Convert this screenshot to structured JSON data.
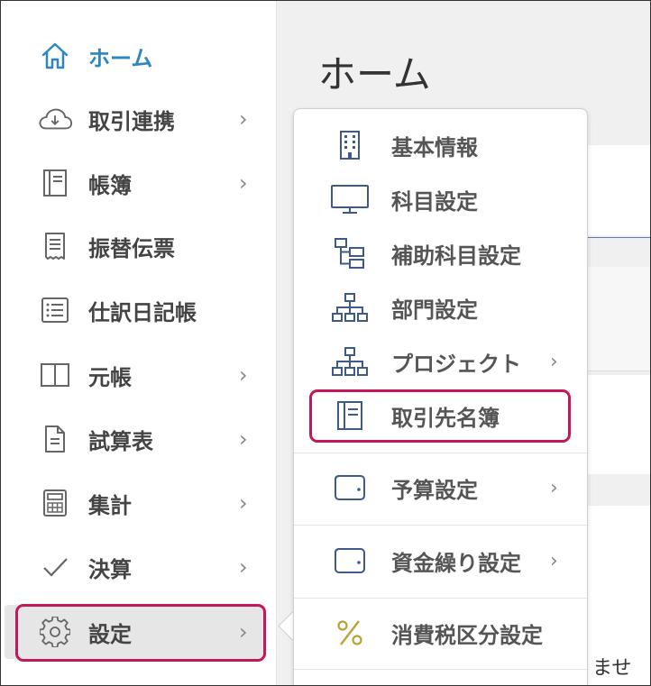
{
  "main": {
    "title": "ホーム",
    "partial_text": "ません"
  },
  "sidebar": {
    "items": [
      {
        "label": "ホーム",
        "icon": "home-icon",
        "chevron": ""
      },
      {
        "label": "取引連携",
        "icon": "cloud-download-icon",
        "chevron": "›"
      },
      {
        "label": "帳簿",
        "icon": "ledger-book-icon",
        "chevron": "›"
      },
      {
        "label": "振替伝票",
        "icon": "receipt-icon",
        "chevron": ""
      },
      {
        "label": "仕訳日記帳",
        "icon": "list-icon",
        "chevron": ""
      },
      {
        "label": "元帳",
        "icon": "open-book-icon",
        "chevron": "›"
      },
      {
        "label": "試算表",
        "icon": "document-icon",
        "chevron": "›"
      },
      {
        "label": "集計",
        "icon": "calculator-icon",
        "chevron": "›"
      },
      {
        "label": "決算",
        "icon": "checkmark-icon",
        "chevron": "›"
      },
      {
        "label": "設定",
        "icon": "gear-icon",
        "chevron": "›"
      }
    ]
  },
  "settings_menu": {
    "items": [
      {
        "label": "基本情報",
        "icon": "building-icon",
        "chevron": ""
      },
      {
        "label": "科目設定",
        "icon": "monitor-icon",
        "chevron": ""
      },
      {
        "label": "補助科目設定",
        "icon": "sub-account-tree-icon",
        "chevron": ""
      },
      {
        "label": "部門設定",
        "icon": "org-chart-icon",
        "chevron": ""
      },
      {
        "label": "プロジェクト",
        "icon": "org-chart-icon",
        "chevron": "›"
      },
      {
        "label": "取引先名簿",
        "icon": "ledger-book-icon",
        "chevron": ""
      },
      {
        "label": "予算設定",
        "icon": "wallet-icon",
        "chevron": "›"
      },
      {
        "label": "資金繰り設定",
        "icon": "wallet-icon",
        "chevron": "›"
      },
      {
        "label": "消費税区分設定",
        "icon": "percent-icon",
        "chevron": ""
      }
    ]
  },
  "colors": {
    "accent": "#2e86c1",
    "highlight": "#c2185b",
    "icon_blue": "#3d5a8a",
    "icon_gold": "#b8a23a"
  }
}
